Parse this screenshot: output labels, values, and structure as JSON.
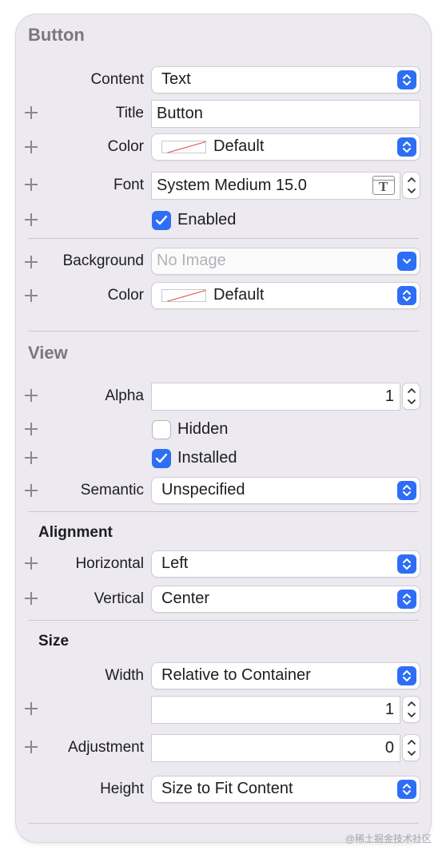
{
  "button_section": {
    "title": "Button",
    "content_label": "Content",
    "content_value": "Text",
    "title_label": "Title",
    "title_value": "Button",
    "color_label": "Color",
    "color_value": "Default",
    "font_label": "Font",
    "font_value": "System Medium 15.0",
    "font_button_glyph": "T",
    "enabled_label": "Enabled",
    "enabled_checked": true,
    "background_label": "Background",
    "background_placeholder": "No Image",
    "bg_color_label": "Color",
    "bg_color_value": "Default"
  },
  "view_section": {
    "title": "View",
    "alpha_label": "Alpha",
    "alpha_value": "1",
    "hidden_label": "Hidden",
    "hidden_checked": false,
    "installed_label": "Installed",
    "installed_checked": true,
    "semantic_label": "Semantic",
    "semantic_value": "Unspecified"
  },
  "alignment_section": {
    "title": "Alignment",
    "horizontal_label": "Horizontal",
    "horizontal_value": "Left",
    "vertical_label": "Vertical",
    "vertical_value": "Center"
  },
  "size_section": {
    "title": "Size",
    "width_label": "Width",
    "width_value": "Relative to Container",
    "width_multiplier": "1",
    "adjustment_label": "Adjustment",
    "adjustment_value": "0",
    "height_label": "Height",
    "height_value": "Size to Fit Content"
  },
  "watermark": "@稀土掘金技术社区",
  "colors": {
    "accent": "#2e6ef5",
    "panel_bg": "#ece9f0",
    "section_title": "#7a777f"
  }
}
